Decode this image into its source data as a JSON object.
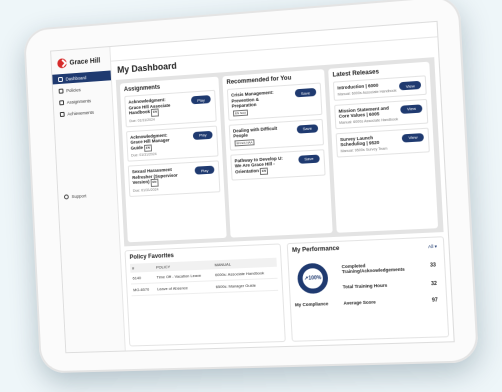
{
  "brand": {
    "name": "Grace Hill"
  },
  "sidebar": {
    "items": [
      {
        "label": "Dashboard",
        "icon": "grid-icon"
      },
      {
        "label": "Policies",
        "icon": "document-icon"
      },
      {
        "label": "Assignments",
        "icon": "clipboard-icon"
      },
      {
        "label": "Achievements",
        "icon": "trophy-icon"
      }
    ],
    "support_label": "Support"
  },
  "page": {
    "title": "My Dashboard"
  },
  "assignments": {
    "title": "Assignments",
    "items": [
      {
        "title": "Acknowledgment: Grace Hill Associate Handbook",
        "tag": "EN",
        "due": "Due: 01/31/2024",
        "action": "Play"
      },
      {
        "title": "Acknowledgment: Grace Hill Manager Guide",
        "tag": "EN",
        "due": "Due: 01/31/2024",
        "action": "Play"
      },
      {
        "title": "Sexual Harassment Refresher (Supervisor Version)",
        "tag": "EN",
        "due": "Due: 01/31/2024",
        "action": "Play"
      }
    ]
  },
  "recommended": {
    "title": "Recommended for You",
    "items": [
      {
        "title": "Crisis Management: Prevention & Preparation",
        "tag": "EN NAA",
        "action": "Save"
      },
      {
        "title": "Dealing with Difficult People",
        "tag": "EN ES NAA",
        "action": "Save"
      },
      {
        "title": "Pathway to Develop U: We Are Grace Hill - Orientation",
        "tag": "EN",
        "action": "Save"
      }
    ]
  },
  "releases": {
    "title": "Latest Releases",
    "items": [
      {
        "title": "Introduction | 6000",
        "sub": "Manual: 6000s Associate Handbook",
        "action": "View"
      },
      {
        "title": "Mission Statement and Core Values | 6005",
        "sub": "Manual: 6000s Associate Handbook",
        "action": "View"
      },
      {
        "title": "Survey Launch Scheduling | 9520",
        "sub": "Manual: 9500s Survey Team",
        "action": "View"
      }
    ]
  },
  "policy_favorites": {
    "title": "Policy Favorites",
    "columns": [
      "#",
      "POLICY",
      "MANUAL"
    ],
    "rows": [
      [
        "6140",
        "Time Off - Vacation Leave",
        "6000s: Associate Handbook"
      ],
      [
        "MG-6570",
        "Leave of Absence",
        "6500s: Manager Guide"
      ]
    ]
  },
  "performance": {
    "title": "My Performance",
    "filter": "All",
    "ring_value": "100%",
    "ring_label": "My Compliance",
    "stats": [
      {
        "label": "Completed Training/Acknowledgements",
        "value": "33"
      },
      {
        "label": "Total Training Hours",
        "value": "32"
      },
      {
        "label": "Average Score",
        "value": "97"
      }
    ]
  },
  "colors": {
    "accent": "#1f3a70",
    "brand_red": "#d62b2b"
  }
}
